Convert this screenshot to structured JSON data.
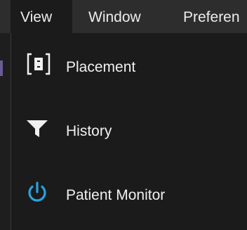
{
  "menubar": {
    "tabs": [
      {
        "label": "View",
        "active": true
      },
      {
        "label": "Window",
        "active": false
      },
      {
        "label": "Preferen",
        "active": false
      }
    ]
  },
  "view_menu": {
    "items": [
      {
        "label": "Placement",
        "icon": "placement-icon"
      },
      {
        "label": "History",
        "icon": "filter-funnel-icon"
      },
      {
        "label": "Patient Monitor",
        "icon": "power-icon"
      }
    ]
  },
  "colors": {
    "menubar_bg": "#2d2d2d",
    "menu_bg": "#1b1b1b",
    "text": "#f0f0f0",
    "power_icon": "#29a3e0"
  }
}
